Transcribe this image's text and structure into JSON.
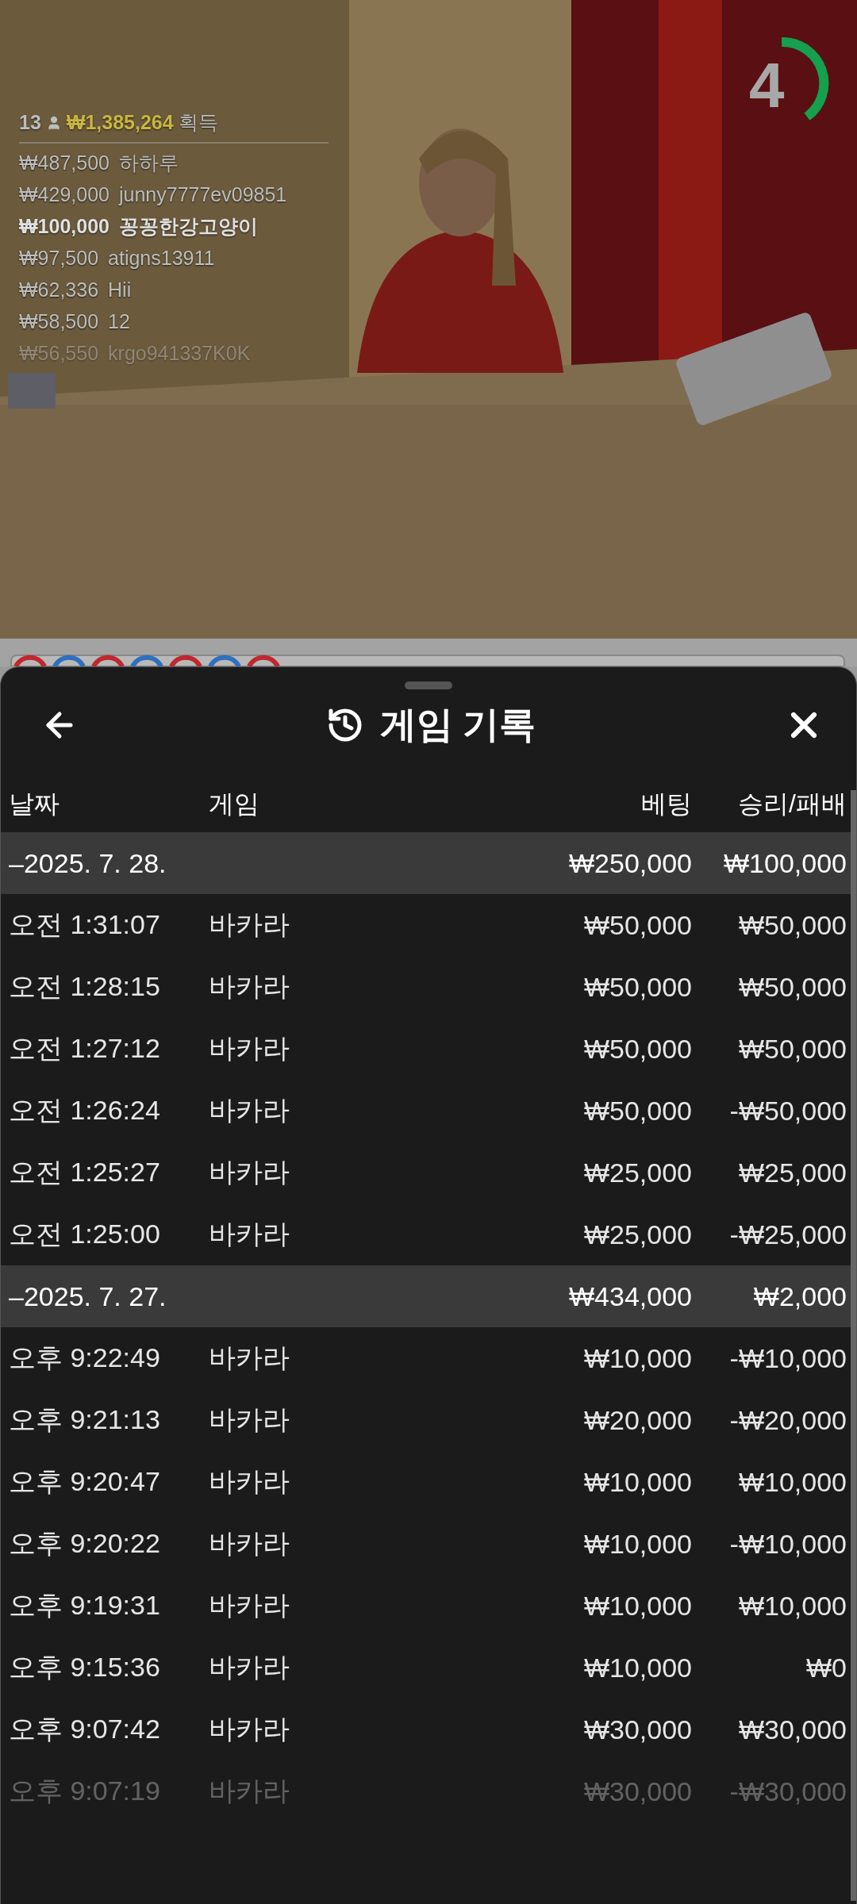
{
  "stream": {
    "kind": "picture",
    "winners": {
      "count": "13",
      "total": "₩1,385,264",
      "total_label": "획득",
      "rows": [
        {
          "amount": "₩487,500",
          "name": "하하루",
          "highlighted": false,
          "faded": false
        },
        {
          "amount": "₩429,000",
          "name": "junny7777ev09851",
          "highlighted": false,
          "faded": false
        },
        {
          "amount": "₩100,000",
          "name": "꽁꽁한강고양이",
          "highlighted": true,
          "faded": false
        },
        {
          "amount": "₩97,500",
          "name": "atigns13911",
          "highlighted": false,
          "faded": false
        },
        {
          "amount": "₩62,336",
          "name": "Hii",
          "highlighted": false,
          "faded": false
        },
        {
          "amount": "₩58,500",
          "name": "12",
          "highlighted": false,
          "faded": false
        },
        {
          "amount": "₩56,550",
          "name": "krgo941337K0K",
          "highlighted": false,
          "faded": true
        }
      ]
    },
    "countdown": {
      "value": "4"
    }
  },
  "road": [
    {
      "color": "#c0282f"
    },
    {
      "color": "#2f6fc0"
    },
    {
      "color": "#c0282f"
    },
    {
      "color": "#2f6fc0"
    },
    {
      "color": "#c0282f"
    },
    {
      "color": "#2f6fc0"
    },
    {
      "color": "#c0282f"
    }
  ],
  "sheet": {
    "title": "게임 기록",
    "columns": [
      "날짜",
      "게임",
      "베팅",
      "승리/패배"
    ],
    "rows": [
      {
        "kind": "date",
        "date": "–2025. 7. 28.",
        "bet": "₩250,000",
        "result": "₩100,000"
      },
      {
        "kind": "entry",
        "time": "오전 1:31:07",
        "game": "바카라",
        "bet": "₩50,000",
        "result": "₩50,000",
        "faded": false
      },
      {
        "kind": "entry",
        "time": "오전 1:28:15",
        "game": "바카라",
        "bet": "₩50,000",
        "result": "₩50,000",
        "faded": false
      },
      {
        "kind": "entry",
        "time": "오전 1:27:12",
        "game": "바카라",
        "bet": "₩50,000",
        "result": "₩50,000",
        "faded": false
      },
      {
        "kind": "entry",
        "time": "오전 1:26:24",
        "game": "바카라",
        "bet": "₩50,000",
        "result": "-₩50,000",
        "faded": false
      },
      {
        "kind": "entry",
        "time": "오전 1:25:27",
        "game": "바카라",
        "bet": "₩25,000",
        "result": "₩25,000",
        "faded": false
      },
      {
        "kind": "entry",
        "time": "오전 1:25:00",
        "game": "바카라",
        "bet": "₩25,000",
        "result": "-₩25,000",
        "faded": false
      },
      {
        "kind": "date",
        "date": "–2025. 7. 27.",
        "bet": "₩434,000",
        "result": "₩2,000"
      },
      {
        "kind": "entry",
        "time": "오후 9:22:49",
        "game": "바카라",
        "bet": "₩10,000",
        "result": "-₩10,000",
        "faded": false
      },
      {
        "kind": "entry",
        "time": "오후 9:21:13",
        "game": "바카라",
        "bet": "₩20,000",
        "result": "-₩20,000",
        "faded": false
      },
      {
        "kind": "entry",
        "time": "오후 9:20:47",
        "game": "바카라",
        "bet": "₩10,000",
        "result": "₩10,000",
        "faded": false
      },
      {
        "kind": "entry",
        "time": "오후 9:20:22",
        "game": "바카라",
        "bet": "₩10,000",
        "result": "-₩10,000",
        "faded": false
      },
      {
        "kind": "entry",
        "time": "오후 9:19:31",
        "game": "바카라",
        "bet": "₩10,000",
        "result": "₩10,000",
        "faded": false
      },
      {
        "kind": "entry",
        "time": "오후 9:15:36",
        "game": "바카라",
        "bet": "₩10,000",
        "result": "₩0",
        "faded": false
      },
      {
        "kind": "entry",
        "time": "오후 9:07:42",
        "game": "바카라",
        "bet": "₩30,000",
        "result": "₩30,000",
        "faded": false
      },
      {
        "kind": "entry",
        "time": "오후 9:07:19",
        "game": "바카라",
        "bet": "₩30,000",
        "result": "-₩30,000",
        "faded": true
      }
    ]
  }
}
